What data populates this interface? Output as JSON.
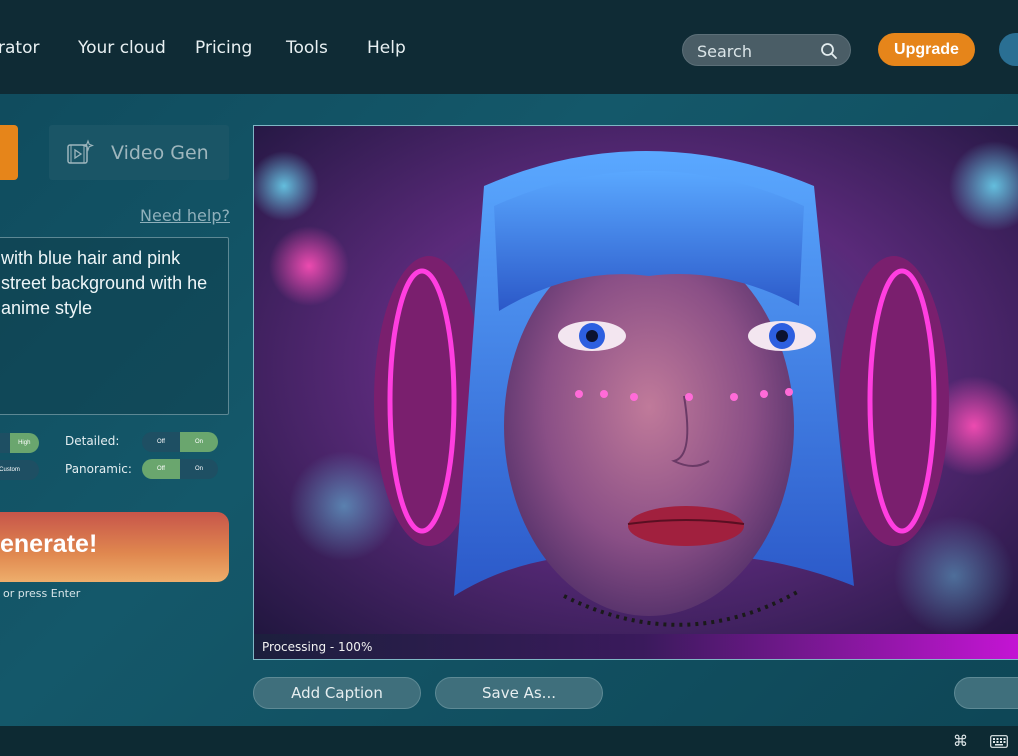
{
  "nav": {
    "items": [
      {
        "label": "rator"
      },
      {
        "label": "Your cloud"
      },
      {
        "label": "Pricing"
      },
      {
        "label": "Tools"
      },
      {
        "label": "Help"
      }
    ],
    "search_placeholder": "Search",
    "upgrade_label": "Upgrade"
  },
  "left": {
    "video_gen_label": "Video Gen",
    "need_help": "Need help?",
    "prompt_text": "with blue hair and pink street background with he anime style",
    "options": {
      "row1_left": {
        "off": "",
        "on": "High"
      },
      "row2_left": {
        "off": "Custom",
        "on": ""
      },
      "detailed_label": "Detailed:",
      "detailed": {
        "off": "Off",
        "on": "On"
      },
      "panoramic_label": "Panoramic:",
      "panoramic": {
        "off": "Off",
        "on": "On"
      }
    },
    "generate_label": "enerate!",
    "hint": "or press Enter"
  },
  "image": {
    "progress_text": "Processing - 100%",
    "progress_value": 1.0
  },
  "actions": {
    "add_caption": "Add Caption",
    "save_as": "Save As..."
  },
  "footer": {
    "cmd_icon": "command-icon",
    "keyboard_icon": "keyboard-icon"
  },
  "colors": {
    "accent": "#e6851a",
    "toggle_on": "#6aa66e",
    "progress_end": "#c914d8"
  }
}
